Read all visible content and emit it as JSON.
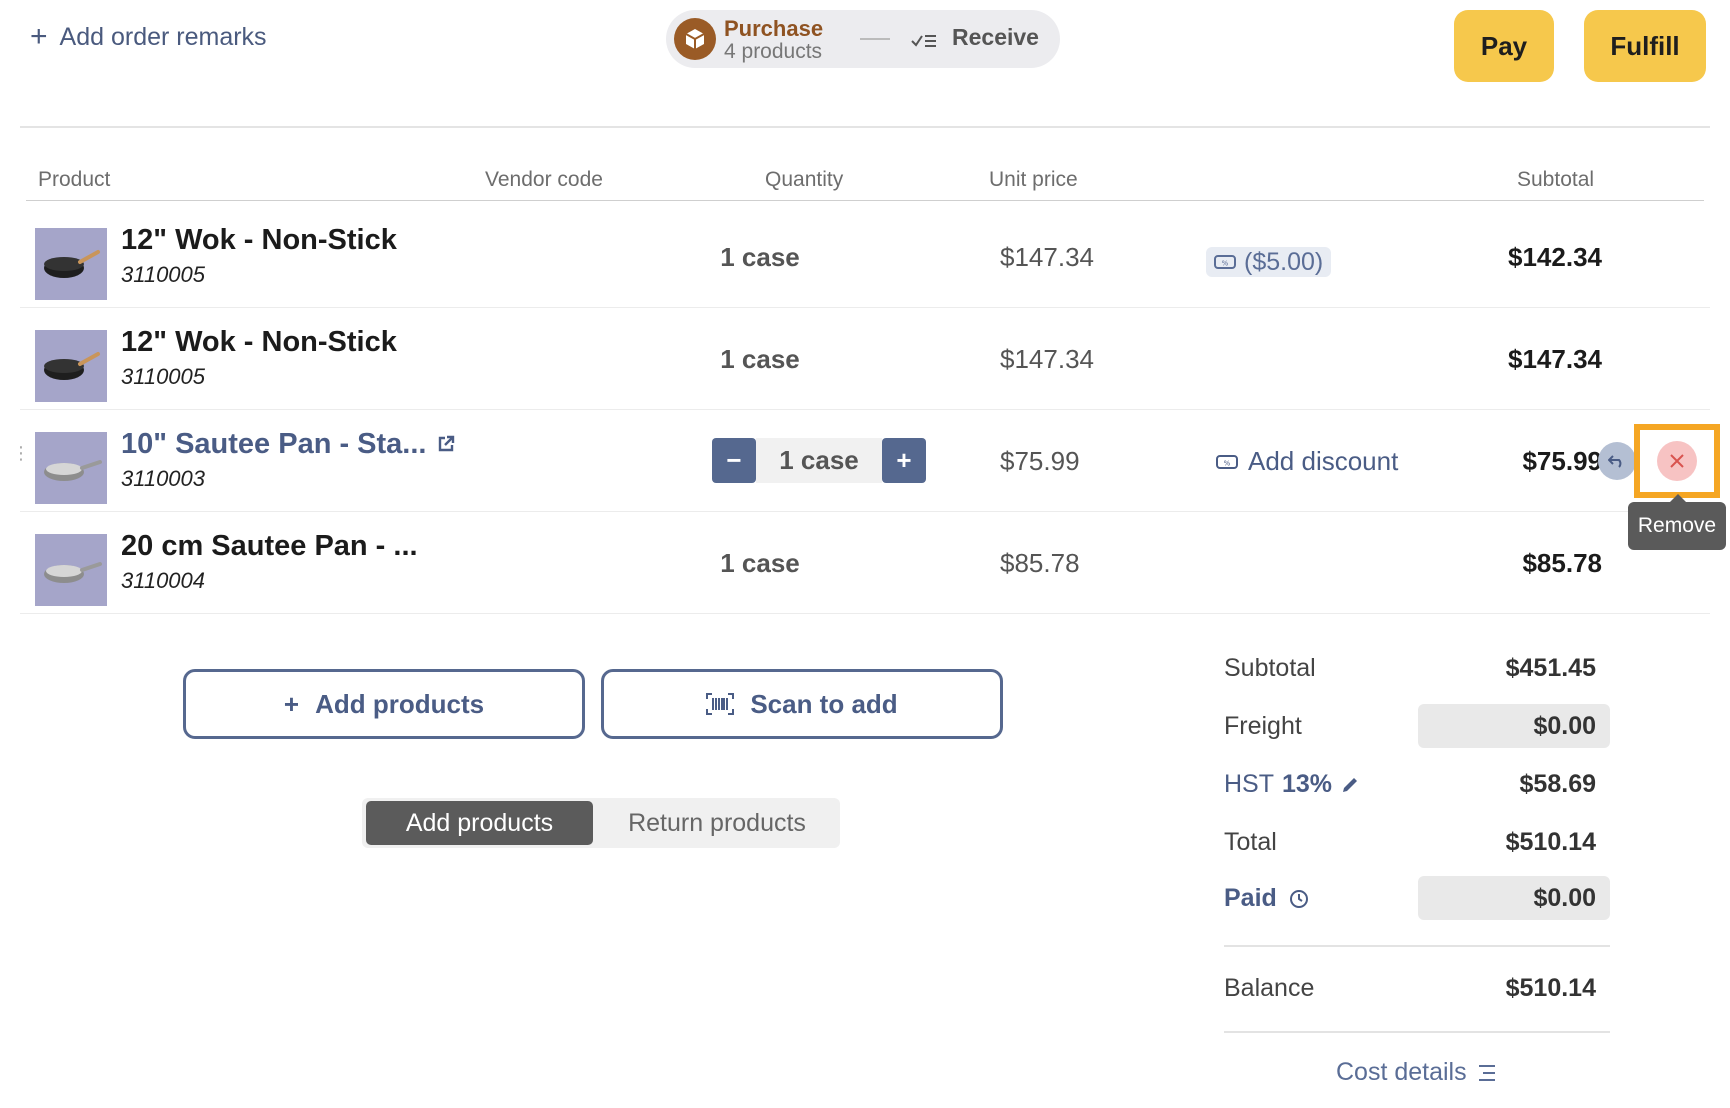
{
  "header": {
    "add_remarks": "Add order remarks",
    "step_purchase_title": "Purchase",
    "step_purchase_sub": "4 products",
    "step_receive": "Receive",
    "pay": "Pay",
    "fulfill": "Fulfill"
  },
  "table": {
    "columns": {
      "product": "Product",
      "vendor_code": "Vendor code",
      "quantity": "Quantity",
      "unit_price": "Unit price",
      "subtotal": "Subtotal"
    },
    "rows": [
      {
        "name": "12\" Wok - Non-Stick",
        "sku": "3110005",
        "qty": "1 case",
        "unit_price": "$147.34",
        "discount": "($5.00)",
        "subtotal": "$142.34"
      },
      {
        "name": "12\" Wok - Non-Stick",
        "sku": "3110005",
        "qty": "1 case",
        "unit_price": "$147.34",
        "subtotal": "$147.34"
      },
      {
        "name": "10\" Sautee Pan - Sta...",
        "sku": "3110003",
        "qty": "1 case",
        "unit_price": "$75.99",
        "add_discount": "Add discount",
        "subtotal": "$75.99",
        "qty_minus": "−",
        "qty_plus": "+"
      },
      {
        "name": "20 cm Sautee Pan - ...",
        "sku": "3110004",
        "qty": "1 case",
        "unit_price": "$85.78",
        "subtotal": "$85.78"
      }
    ],
    "tooltip": "Remove"
  },
  "actions": {
    "add_products": "Add products",
    "scan_to_add": "Scan to add",
    "add_plus": "+"
  },
  "mode": {
    "add": "Add products",
    "return": "Return products"
  },
  "totals": {
    "subtotal_label": "Subtotal",
    "subtotal": "$451.45",
    "freight_label": "Freight",
    "freight": "$0.00",
    "tax_label": "HST",
    "tax_rate": "13%",
    "tax": "$58.69",
    "total_label": "Total",
    "total": "$510.14",
    "paid_label": "Paid",
    "paid": "$0.00",
    "balance_label": "Balance",
    "balance": "$510.14",
    "cost_details": "Cost details"
  }
}
